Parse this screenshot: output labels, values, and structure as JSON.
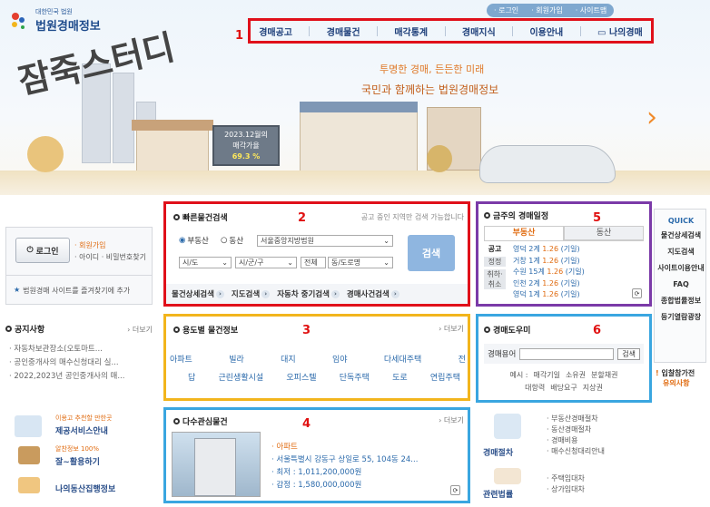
{
  "util": {
    "login": "· 로그인",
    "join": "· 회원가입",
    "sitemap": "· 사이트맵"
  },
  "logo": {
    "sub": "대한민국 법원",
    "title": "법원경매정보"
  },
  "nav": {
    "num": "1",
    "items": [
      "경매공고",
      "경매물건",
      "매각통계",
      "경매지식",
      "이용안내",
      "나의경매"
    ]
  },
  "hero": {
    "slogan1": "투명한 경매, 든든한 미래",
    "slogan2": "국민과 함께하는 법원경매정보",
    "sign_line1": "2023.12월의",
    "sign_line2": "매각가율",
    "sign_value": "69.3 %",
    "watermark": "잠죽스터디"
  },
  "login": {
    "button": "로그인",
    "join": "· 회원가입",
    "find": "· 아이디 · 비밀번호찾기",
    "fav": "법원경매 사이트를 즐겨찾기에 추가"
  },
  "notice": {
    "title": "공지사항",
    "more": "› 더보기",
    "items": [
      "· 자동차보관장소(오토마트...",
      "· 공인중개사의 매수신청대리 실...",
      "· 2022,2023년 공인중개사의 매..."
    ]
  },
  "promo": {
    "p1_small": "이용고 추천할 만한곳",
    "p1": "제공서비스안내",
    "p2_small": "알찬정보 100%",
    "p2": "잘~활용하기",
    "p3": "나의동산집행정보"
  },
  "quick_search": {
    "num": "2",
    "title": "빠른물건검색",
    "hint": "공고 중인 지역만 검색 가능합니다",
    "radio1": "부동산",
    "radio2": "동산",
    "court": "서울중앙지방법원",
    "sido": "시/도",
    "sigungu": "시/군/구",
    "jeonche": "전체",
    "dong": "동/도로명",
    "search_btn": "검색",
    "links": [
      "물건상세검색",
      "지도검색",
      "자동차 중기검색",
      "경매사건검색"
    ]
  },
  "usage": {
    "num": "3",
    "title": "용도별 물건정보",
    "more": "› 더보기",
    "row1": [
      "아파트",
      "빌라",
      "대지",
      "임야",
      "다세대주택",
      "전"
    ],
    "row2": [
      "답",
      "근린생활시설",
      "오피스텔",
      "단독주택",
      "도로",
      "연립주택"
    ]
  },
  "popular": {
    "num": "4",
    "title": "다수관심물건",
    "more": "› 더보기",
    "type": "· 아파트",
    "addr": "· 서울특별시 강동구 상일로 55, 104동 24...",
    "min": "· 최저 : 1,011,200,000원",
    "appraisal": "· 감정 : 1,580,000,000원"
  },
  "schedule": {
    "num": "5",
    "title": "금주의 경매일정",
    "tab1": "부동산",
    "tab2": "동산",
    "labels": [
      "공고",
      "정정",
      "취하·취소"
    ],
    "rows": [
      {
        "place": "영덕",
        "n": "2계",
        "d": "1.26",
        "s": "(기일)"
      },
      {
        "place": "거창",
        "n": "1계",
        "d": "1.26",
        "s": "(기일)"
      },
      {
        "place": "수원",
        "n": "15계",
        "d": "1.26",
        "s": "(기일)"
      },
      {
        "place": "인천",
        "n": "2계",
        "d": "1.26",
        "s": "(기일)"
      },
      {
        "place": "영덕",
        "n": "1계",
        "d": "1.26",
        "s": "(기일)"
      }
    ]
  },
  "dict": {
    "num": "6",
    "title": "경매도우미",
    "label": "경매용어",
    "btn": "검색",
    "ex_label": "예시 :",
    "ex": [
      "매각기일",
      "소유권",
      "분할채권",
      "대항력",
      "배당요구",
      "지상권"
    ]
  },
  "procedure": {
    "c1": "경매절차",
    "c2": "관련법률",
    "list1": [
      "· 부동산경매절차",
      "· 동산경매절차",
      "· 경매비용",
      "· 매수신청대리안내"
    ],
    "list2": [
      "· 주택임대차",
      "· 상가임대차"
    ]
  },
  "quick": {
    "title": "QUICK",
    "items": [
      "물건상세검색",
      "지도검색",
      "사이트이용안내",
      "FAQ",
      "종합법률정보",
      "등기열람광장"
    ],
    "notice1": "입찰참가전",
    "notice2": "유의사항"
  },
  "colors": {
    "red": "#e0101a",
    "yellow": "#f2b51c",
    "blue": "#3aa6e0",
    "purple": "#7b3aa8"
  }
}
